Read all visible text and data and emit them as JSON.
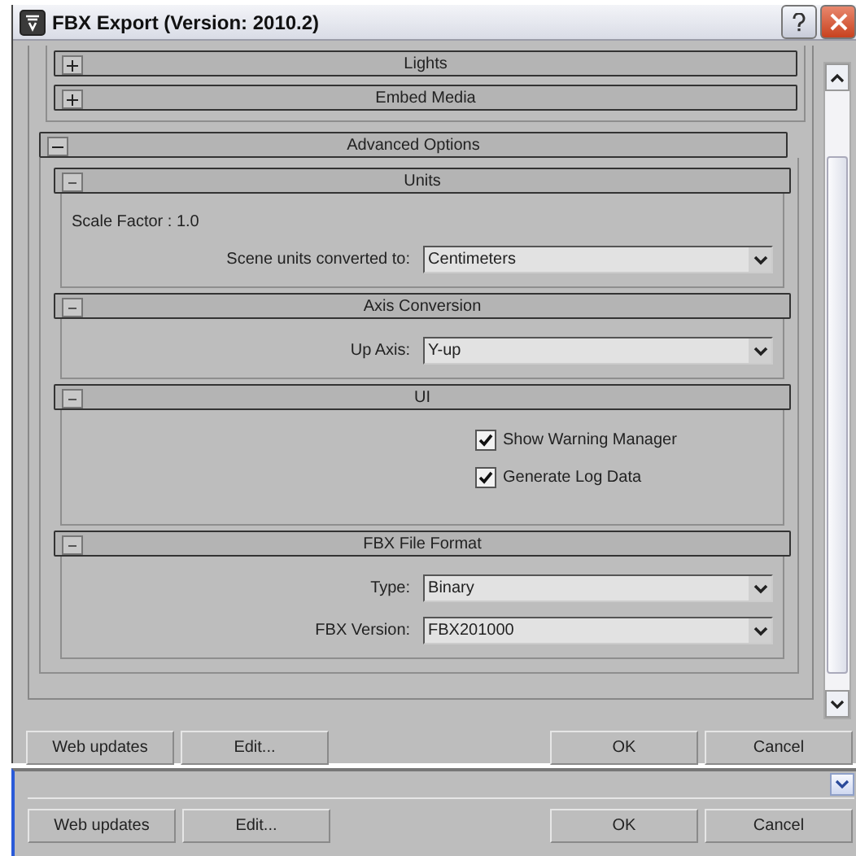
{
  "window": {
    "title": "FBX Export (Version: 2010.2)"
  },
  "rollouts": [
    {
      "label": "Lights",
      "expanded": false
    },
    {
      "label": "Embed Media",
      "expanded": false
    },
    {
      "label": "Advanced Options",
      "expanded": true,
      "sections": [
        {
          "label": "Units",
          "expanded": true,
          "rows": [
            {
              "kind": "text",
              "text": "Scale Factor : 1.0"
            },
            {
              "kind": "dropdown",
              "label": "Scene units converted to:",
              "value": "Centimeters"
            }
          ]
        },
        {
          "label": "Axis Conversion",
          "expanded": true,
          "rows": [
            {
              "kind": "dropdown",
              "label": "Up Axis:",
              "value": "Y-up"
            }
          ]
        },
        {
          "label": "UI",
          "expanded": true,
          "rows": [
            {
              "kind": "checkbox",
              "label": "Show Warning Manager",
              "checked": true
            },
            {
              "kind": "checkbox",
              "label": "Generate Log Data",
              "checked": true
            }
          ]
        },
        {
          "label": "FBX File Format",
          "expanded": true,
          "rows": [
            {
              "kind": "dropdown",
              "label": "Type:",
              "value": "Binary"
            },
            {
              "kind": "dropdown",
              "label": "FBX Version:",
              "value": "FBX201000"
            }
          ]
        }
      ]
    }
  ],
  "buttons": [
    {
      "label": "Web updates"
    },
    {
      "label": "Edit..."
    },
    {
      "label": "OK"
    },
    {
      "label": "Cancel"
    }
  ],
  "bottom_buttons": [
    {
      "label": "Web updates"
    },
    {
      "label": "Edit..."
    },
    {
      "label": "OK"
    },
    {
      "label": "Cancel"
    }
  ]
}
